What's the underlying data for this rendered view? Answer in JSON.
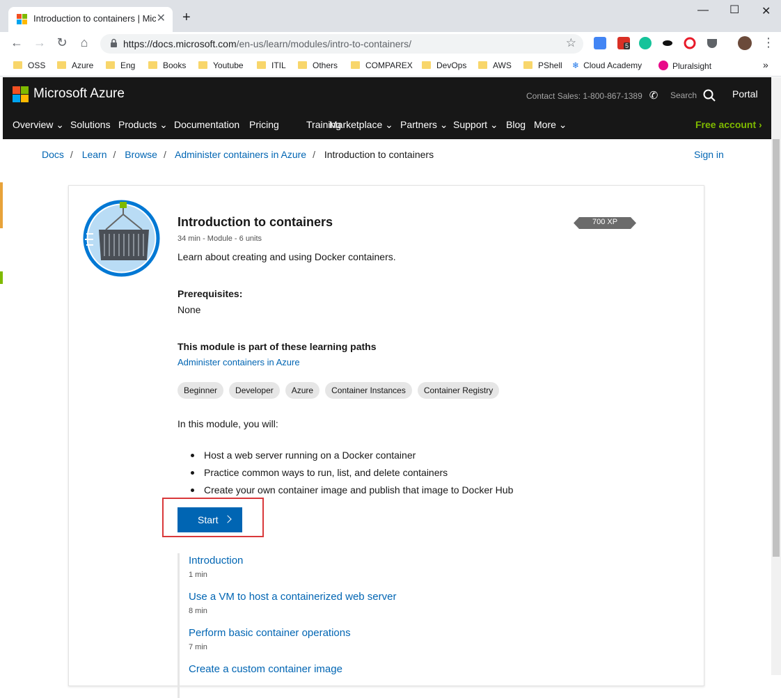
{
  "browser": {
    "tab_title": "Introduction to containers | Micro",
    "url_host": "https://docs.microsoft.com",
    "url_path": "/en-us/learn/modules/intro-to-containers/",
    "bookmarks": [
      "OSS",
      "Azure",
      "Eng",
      "Books",
      "Youtube",
      "ITIL",
      "Others",
      "COMPAREX",
      "DevOps",
      "AWS",
      "PShell",
      "Cloud Academy",
      "Pluralsight"
    ],
    "extension_badge": "5"
  },
  "header": {
    "brand": "Microsoft Azure",
    "contact": "Contact Sales: 1-800-867-1389",
    "search_label": "Search",
    "portal": "Portal",
    "nav": [
      "Overview",
      "Solutions",
      "Products",
      "Documentation",
      "Pricing",
      "Training",
      "Marketplace",
      "Partners",
      "Support",
      "Blog",
      "More"
    ],
    "free_account": "Free account"
  },
  "breadcrumb": {
    "items": [
      "Docs",
      "Learn",
      "Browse",
      "Administer containers in Azure"
    ],
    "current": "Introduction to containers",
    "sign_in": "Sign in"
  },
  "module": {
    "title": "Introduction to containers",
    "meta": "34 min - Module - 6 units",
    "xp": "700 XP",
    "summary": "Learn about creating and using Docker containers.",
    "prereq_heading": "Prerequisites:",
    "prereq": "None",
    "paths_heading": "This module is part of these learning paths",
    "path_link": "Administer containers in Azure",
    "tags": [
      "Beginner",
      "Developer",
      "Azure",
      "Container Instances",
      "Container Registry"
    ],
    "intro": "In this module, you will:",
    "goals": [
      "Host a web server running on a Docker container",
      "Practice common ways to run, list, and delete containers",
      "Create your own container image and publish that image to Docker Hub"
    ],
    "start_label": "Start",
    "units": [
      {
        "title": "Introduction",
        "time": "1 min"
      },
      {
        "title": "Use a VM to host a containerized web server",
        "time": "8 min"
      },
      {
        "title": "Perform basic container operations",
        "time": "7 min"
      },
      {
        "title": "Create a custom container image",
        "time": ""
      }
    ]
  },
  "colors": {
    "accent": "#0065b3",
    "header_bg": "#171717",
    "free_account": "#7fba00",
    "highlight_box": "#d9383a"
  }
}
